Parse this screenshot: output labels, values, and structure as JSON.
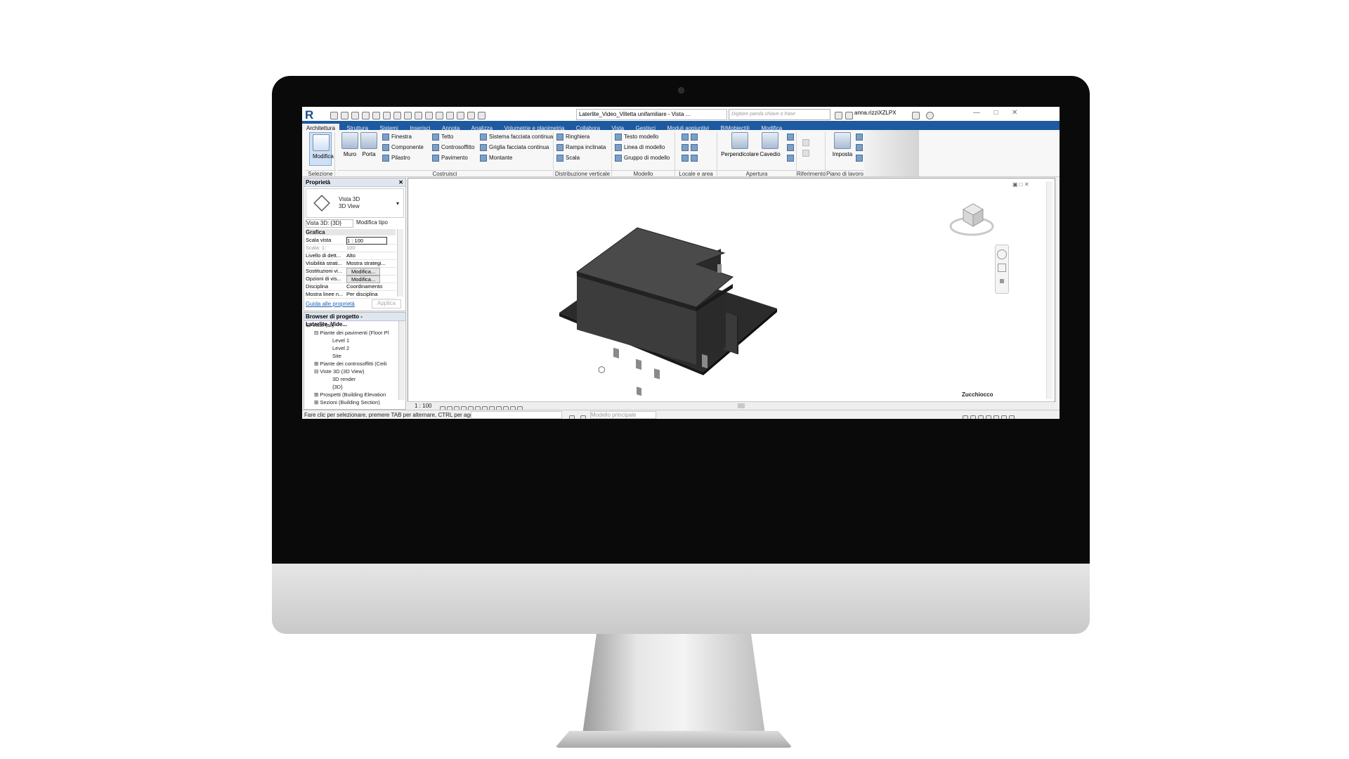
{
  "app": {
    "logo_letter": "R",
    "document_title": "Laterlite_Video_Villetta unifamiliare - Vista ...",
    "search_placeholder": "Digitare parola chiave o frase",
    "user": "anna.rizziXZLPX"
  },
  "tabs": [
    "Architettura",
    "Struttura",
    "Sistemi",
    "Inserisci",
    "Annota",
    "Analizza",
    "Volumetrie e planimetria",
    "Collabora",
    "Vista",
    "Gestisci",
    "Moduli aggiuntivi",
    "BIMobject®",
    "Modifica"
  ],
  "active_tab": "Architettura",
  "ribbon": {
    "modifica": "Modifica",
    "muro": "Muro",
    "porta": "Porta",
    "costruisci_items": [
      "Finestra",
      "Componente",
      "Pilastro",
      "Tetto",
      "Controsoffitto",
      "Pavimento",
      "Sistema facciata continua",
      "Griglia facciata continua",
      "Montante"
    ],
    "circolazione_items": [
      "Ringhiera",
      "Rampa inclinata",
      "Scala"
    ],
    "modello_items": [
      "Testo modello",
      "Linea di modello",
      "Gruppo di modello"
    ],
    "apertura_items": [
      "Perpendicolare",
      "Cavedio"
    ],
    "piano_items": [
      "Imposta"
    ],
    "panels": [
      "Selezione",
      "Costruisci",
      "Distribuzione verticale",
      "Modello",
      "Locale e area",
      "Apertura",
      "Riferimento",
      "Piano di lavoro"
    ]
  },
  "properties": {
    "header": "Proprietà",
    "type_name": "Vista 3D",
    "type_sub": "3D View",
    "instance": "Vista 3D: {3D}",
    "edit_type": "Modifica tipo",
    "group": "Grafica",
    "rows": [
      {
        "label": "Scala vista",
        "value": "1 : 100"
      },
      {
        "label": "Scala: 1:",
        "value": "100"
      },
      {
        "label": "Livello di dett...",
        "value": "Alto"
      },
      {
        "label": "Visibilità strati...",
        "value": "Mostra strategi..."
      },
      {
        "label": "Sostituzioni vi...",
        "value": "Modifica..."
      },
      {
        "label": "Opzioni di vis...",
        "value": "Modifica..."
      },
      {
        "label": "Disciplina",
        "value": "Coordinamento"
      },
      {
        "label": "Mostra linee n...",
        "value": "Per disciplina"
      }
    ],
    "help_link": "Guida alle proprietà",
    "apply": "Applica"
  },
  "project_browser": {
    "header": "Browser di progetto - Laterlite_Vide...",
    "items": [
      "Viste (all)",
      "Piante dei pavimenti (Floor Pl",
      "Level 1",
      "Level 2",
      "Site",
      "Piante dei controsoffitti (Ceili",
      "Viste 3D (3D View)",
      "3D render",
      "{3D}",
      "Prospetti (Building Elevation",
      "Sezioni (Building Section)"
    ]
  },
  "view": {
    "scale": "1 : 100",
    "model_label": "Modello principale",
    "watermark": "Zucchiocco"
  },
  "status": {
    "message": "Fare clic per selezionare, premere TAB per alternare, CTRL per agg"
  },
  "colors": {
    "ribbon_tab_bar": "#1e5aa0",
    "model": "#3c3c3c"
  }
}
